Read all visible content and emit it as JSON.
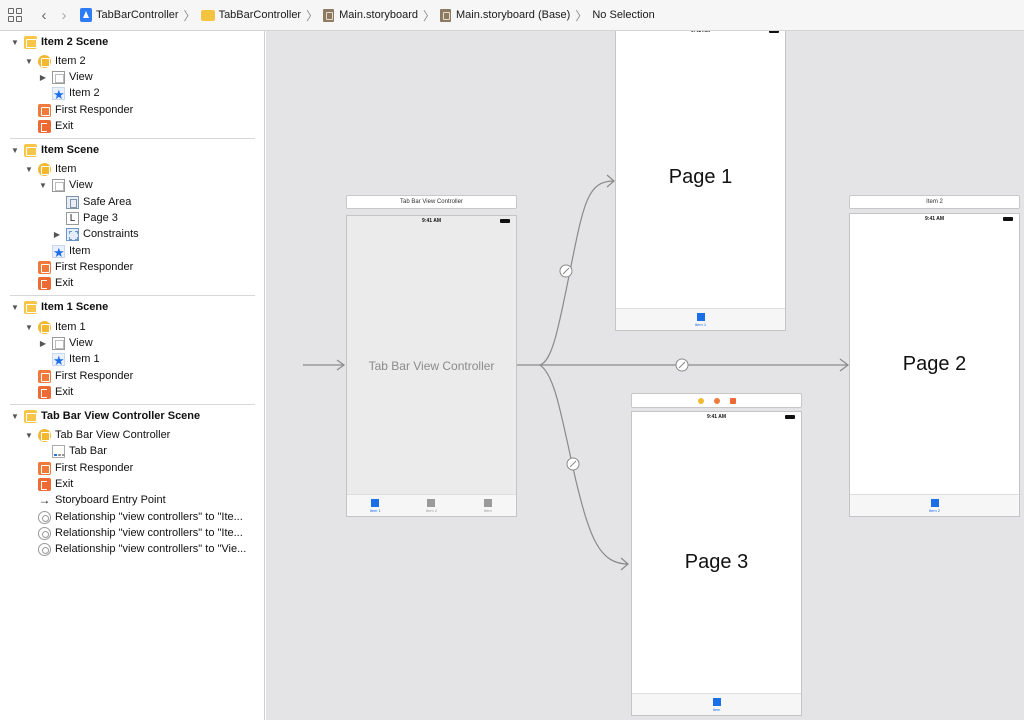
{
  "breadcrumb": {
    "items": [
      "TabBarController",
      "TabBarController",
      "Main.storyboard",
      "Main.storyboard (Base)",
      "No Selection"
    ]
  },
  "outline": {
    "sections": [
      {
        "title": "Item 2 Scene",
        "rows": [
          {
            "label": "Item 2",
            "icon": "view-controller-icon"
          },
          {
            "label": "View",
            "icon": "view-icon"
          },
          {
            "label": "Item 2",
            "icon": "tab-bar-item-icon"
          },
          {
            "label": "First Responder",
            "icon": "first-responder-icon"
          },
          {
            "label": "Exit",
            "icon": "exit-icon"
          }
        ]
      },
      {
        "title": "Item Scene",
        "rows": [
          {
            "label": "Item",
            "icon": "view-controller-icon"
          },
          {
            "label": "View",
            "icon": "view-icon"
          },
          {
            "label": "Safe Area",
            "icon": "safe-area-icon"
          },
          {
            "label": "Page 3",
            "icon": "label-icon"
          },
          {
            "label": "Constraints",
            "icon": "constraints-icon"
          },
          {
            "label": "Item",
            "icon": "tab-bar-item-icon"
          },
          {
            "label": "First Responder",
            "icon": "first-responder-icon"
          },
          {
            "label": "Exit",
            "icon": "exit-icon"
          }
        ]
      },
      {
        "title": "Item 1 Scene",
        "rows": [
          {
            "label": "Item 1",
            "icon": "view-controller-icon"
          },
          {
            "label": "View",
            "icon": "view-icon"
          },
          {
            "label": "Item 1",
            "icon": "tab-bar-item-icon"
          },
          {
            "label": "First Responder",
            "icon": "first-responder-icon"
          },
          {
            "label": "Exit",
            "icon": "exit-icon"
          }
        ]
      },
      {
        "title": "Tab Bar View Controller Scene",
        "rows": [
          {
            "label": "Tab Bar View Controller",
            "icon": "tab-bar-controller-icon"
          },
          {
            "label": "Tab Bar",
            "icon": "tab-bar-icon"
          },
          {
            "label": "First Responder",
            "icon": "first-responder-icon"
          },
          {
            "label": "Exit",
            "icon": "exit-icon"
          },
          {
            "label": "Storyboard Entry Point",
            "icon": "entry-arrow-icon"
          },
          {
            "label": "Relationship \"view controllers\" to \"Ite...",
            "icon": "relationship-icon"
          },
          {
            "label": "Relationship \"view controllers\" to \"Ite...",
            "icon": "relationship-icon"
          },
          {
            "label": "Relationship \"view controllers\" to \"Vie...",
            "icon": "relationship-icon"
          }
        ]
      }
    ]
  },
  "canvas": {
    "status_time": "9:41 AM",
    "tab_bar_controller": {
      "title": "Tab Bar View Controller",
      "center_label": "Tab Bar View Controller",
      "tabs": [
        "Item 1",
        "Item 2",
        "Item"
      ]
    },
    "page1": {
      "label": "Page 1",
      "tab": "Item 1"
    },
    "page2": {
      "title": "Item 2",
      "label": "Page 2",
      "tab": "Item 2"
    },
    "page3": {
      "label": "Page 3",
      "tab": "Item"
    }
  },
  "colors": {
    "accent": "#1a6fe8",
    "canvas_bg": "#e4e4e6",
    "scene_icon": "#f7c648",
    "responder_icon": "#f07a3c"
  }
}
